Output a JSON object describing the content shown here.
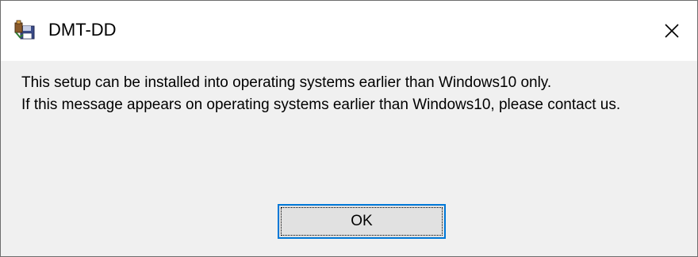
{
  "window": {
    "title": "DMT-DD",
    "app_icon": "installer-icon",
    "close_icon": "close-icon"
  },
  "message": {
    "line1": "This setup can be installed into operating systems earlier than Windows10 only.",
    "line2": "If this message appears on operating systems earlier than Windows10, please contact us."
  },
  "buttons": {
    "ok_label": "OK"
  },
  "colors": {
    "focus_border": "#0078d7",
    "dialog_background": "#f0f0f0",
    "titlebar_background": "#ffffff",
    "button_face": "#e1e1e1"
  }
}
